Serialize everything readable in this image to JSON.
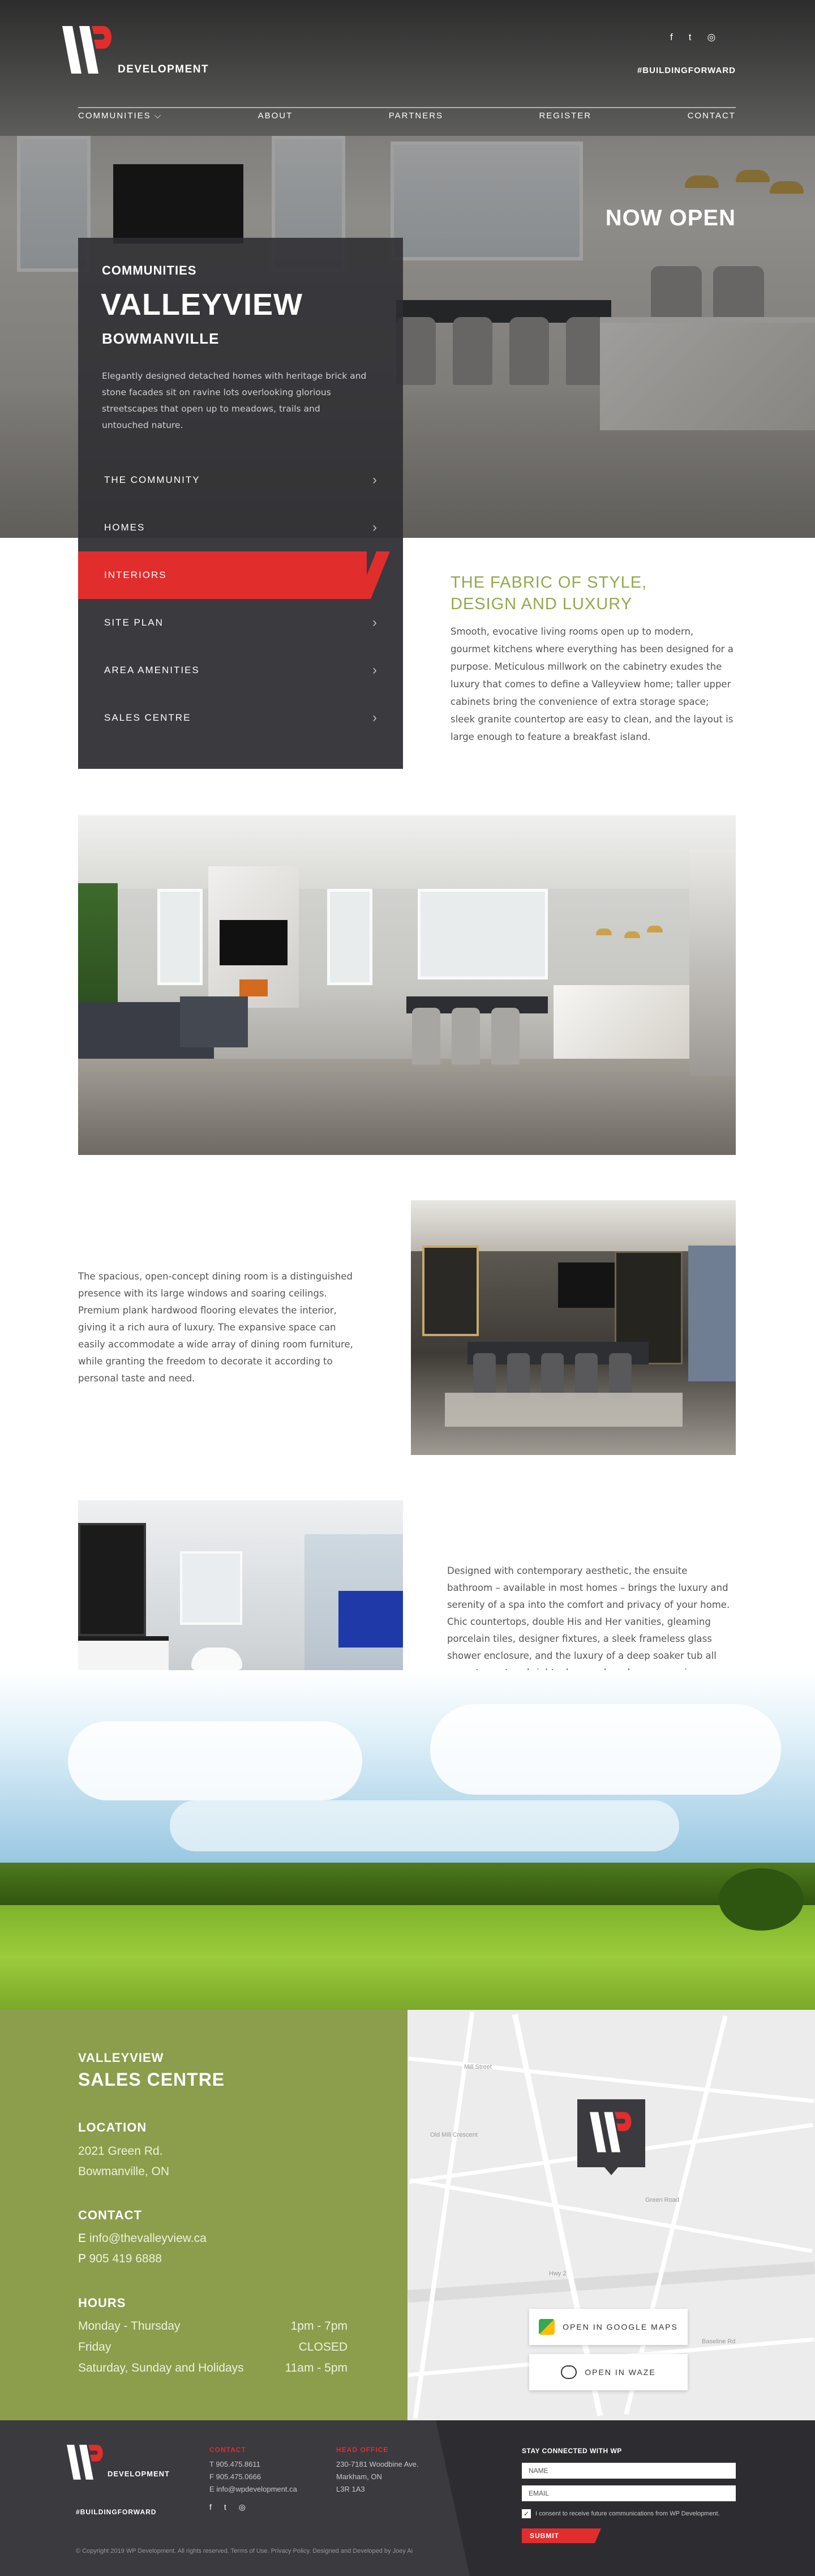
{
  "brand": {
    "word": "DEVELOPMENT",
    "hashtag": "#BUILDINGFORWARD",
    "accent": "#e22d2d",
    "olive": "#8c9d4c"
  },
  "social": [
    "f",
    "t",
    "◎"
  ],
  "nav": {
    "items": [
      "COMMUNITIES ⌵",
      "ABOUT",
      "PARTNERS",
      "REGISTER",
      "CONTACT"
    ]
  },
  "hero": {
    "badge": "NOW OPEN"
  },
  "panel": {
    "kicker": "COMMUNITIES",
    "title": "VALLEYVIEW",
    "subtitle": "BOWMANVILLE",
    "description": "Elegantly designed detached homes with heritage brick and stone facades sit on ravine lots overlooking glorious streetscapes that open up to meadows, trails and untouched nature.",
    "menu": [
      "THE COMMUNITY",
      "HOMES",
      "INTERIORS",
      "SITE PLAN",
      "AREA AMENITIES",
      "SALES CENTRE"
    ],
    "active_index": 2
  },
  "fabric": {
    "heading_line1": "THE FABRIC OF STYLE,",
    "heading_line2": "DESIGN AND LUXURY",
    "body": "Smooth, evocative living rooms open up to modern, gourmet kitchens where everything has been designed for a purpose. Meticulous millwork on the cabinetry exudes the luxury that comes to define a Valleyview home; taller upper cabinets bring the convenience of extra storage space; sleek granite countertop are easy to clean, and the layout is large enough to feature a breakfast island."
  },
  "dining": {
    "body": "The spacious, open-concept dining room is a distinguished presence with its large windows and soaring ceilings. Premium plank hardwood flooring elevates the interior, giving it a rich aura of luxury. The expansive space can easily accommodate a wide array of dining room furniture, while granting the freedom to decorate it according to personal taste and need."
  },
  "bath": {
    "body": "Designed with contemporary aesthetic, the ensuite bathroom – available in most homes – brings  the luxury and serenity of a spa into the comfort and privacy of your home. Chic countertops, double His and Her vanities, gleaming porcelain tiles, designer fixtures, a sleek frameless glass shower enclosure, and the luxury of a deep soaker tub all serve to capture bright, clean and modern expression – timeless style at its best."
  },
  "sales": {
    "kicker": "VALLEYVIEW",
    "title": "SALES CENTRE",
    "location_h": "LOCATION",
    "address1": "2021 Green Rd.",
    "address2": "Bowmanville, ON",
    "contact_h": "CONTACT",
    "email_label": "E",
    "email": "info@thevalleyview.ca",
    "phone_label": "P",
    "phone": "905 419 6888",
    "hours_h": "HOURS",
    "hours": [
      {
        "day": "Monday - Thursday",
        "time": "1pm - 7pm"
      },
      {
        "day": "Friday",
        "time": "CLOSED"
      },
      {
        "day": "Saturday, Sunday and Holidays",
        "time": "11am - 5pm"
      }
    ]
  },
  "map": {
    "google": "OPEN IN GOOGLE MAPS",
    "waze": "OPEN IN WAZE",
    "labels": [
      "Mill Street",
      "Old Mill Crescent",
      "Hwy 2",
      "Green Road",
      "Baseline Rd"
    ]
  },
  "footer": {
    "hashtag": "#BUILDINGFORWARD",
    "contact_h": "CONTACT",
    "contact_lines": [
      "T 905.475.8611",
      "F 905.475.0666",
      "E info@wpdevelopment.ca"
    ],
    "office_h": "HEAD OFFICE",
    "office_lines": [
      "230-7181 Woodbine Ave.",
      "Markham, ON",
      "L3R 1A3"
    ],
    "newsletter_h": "STAY CONNECTED WITH WP",
    "name_ph": "NAME",
    "email_ph": "EMAIL",
    "consent": "I consent to receive future communications from WP Development.",
    "submit": "SUBMIT",
    "copyright": "© Copyright 2019 WP Development. All rights reserved. Terms of Use. Privacy Policy. Designed and Developed by Joey Ai"
  }
}
